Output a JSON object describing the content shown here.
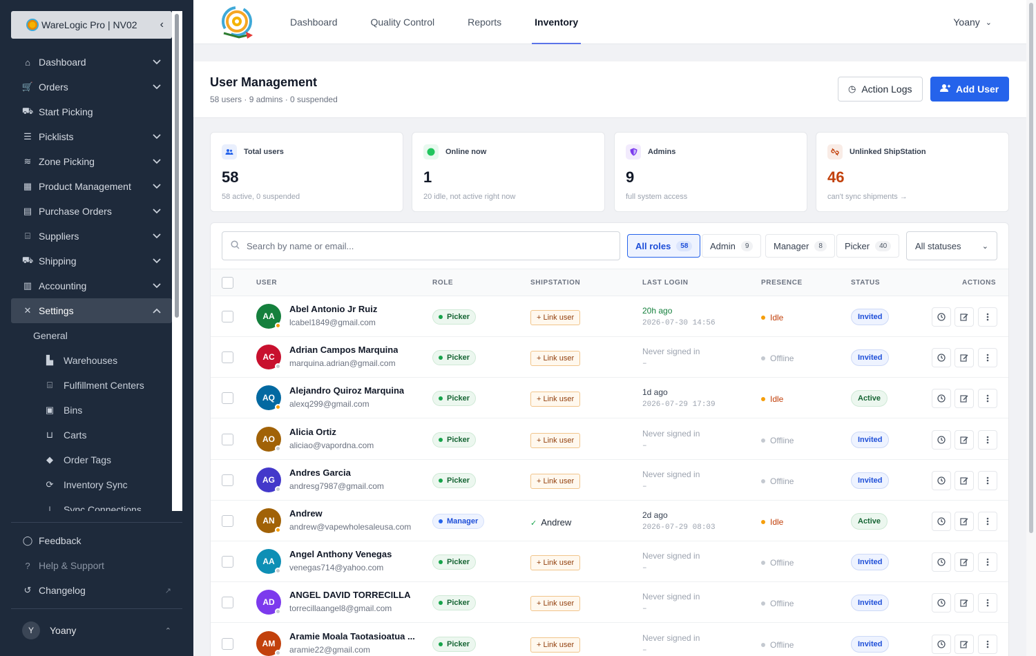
{
  "org": {
    "name": "WareLogic Pro | NV02"
  },
  "sidebar": {
    "items": [
      {
        "label": "Dashboard",
        "icon": "home-icon",
        "has_chevron": true
      },
      {
        "label": "Orders",
        "icon": "cart-icon",
        "has_chevron": true
      },
      {
        "label": "Start Picking",
        "icon": "dolly-icon",
        "has_chevron": false
      },
      {
        "label": "Picklists",
        "icon": "list-icon",
        "has_chevron": true
      },
      {
        "label": "Zone Picking",
        "icon": "layers-icon",
        "has_chevron": true
      },
      {
        "label": "Product Management",
        "icon": "boxes-icon",
        "has_chevron": true
      },
      {
        "label": "Purchase Orders",
        "icon": "document-icon",
        "has_chevron": true
      },
      {
        "label": "Suppliers",
        "icon": "warehouse-icon",
        "has_chevron": true
      },
      {
        "label": "Shipping",
        "icon": "truck-icon",
        "has_chevron": true
      },
      {
        "label": "Accounting",
        "icon": "calculator-icon",
        "has_chevron": true
      },
      {
        "label": "Settings",
        "icon": "tools-icon",
        "has_chevron": true,
        "active": true
      }
    ],
    "settings_group": "General",
    "sub_items": [
      {
        "label": "Warehouses",
        "icon": "industry-icon"
      },
      {
        "label": "Fulfillment Centers",
        "icon": "warehouse-icon"
      },
      {
        "label": "Bins",
        "icon": "box-open-icon"
      },
      {
        "label": "Carts",
        "icon": "cart-flatbed-icon"
      },
      {
        "label": "Order Tags",
        "icon": "tags-icon"
      },
      {
        "label": "Inventory Sync",
        "icon": "sync-icon"
      },
      {
        "label": "Sync Connections",
        "icon": "plug-icon"
      }
    ],
    "bottom": [
      {
        "label": "Feedback",
        "icon": "chat-icon"
      },
      {
        "label": "Help & Support",
        "icon": "help-icon"
      },
      {
        "label": "Changelog",
        "icon": "history-icon"
      }
    ],
    "user": {
      "initial": "Y",
      "name": "Yoany"
    }
  },
  "topnav": {
    "tabs": [
      "Dashboard",
      "Quality Control",
      "Reports",
      "Inventory"
    ],
    "active_tab": "Inventory",
    "user": "Yoany"
  },
  "header": {
    "title": "User Management",
    "subtitle": "58 users · 9 admins · 0 suspended",
    "action_logs": "Action Logs",
    "add_user": "Add User"
  },
  "stats": [
    {
      "label": "Total users",
      "value": "58",
      "note": "58 active, 0 suspended",
      "icon": "users-icon",
      "accent": "#2563eb"
    },
    {
      "label": "Online now",
      "value": "1",
      "note": "20 idle, not active right now",
      "icon": "online-dot-icon",
      "accent": "#22c55e"
    },
    {
      "label": "Admins",
      "value": "9",
      "note": "full system access",
      "icon": "shield-icon",
      "accent": "#7c3aed"
    },
    {
      "label": "Unlinked ShipStation",
      "value": "46",
      "note": "can't sync shipments →",
      "icon": "unlink-icon",
      "accent": "#c2410c"
    }
  ],
  "filters": {
    "search_placeholder": "Search by name or email...",
    "roles": [
      {
        "label": "All roles",
        "count": "58",
        "active": true
      },
      {
        "label": "Admin",
        "count": "9"
      },
      {
        "label": "Manager",
        "count": "8"
      },
      {
        "label": "Picker",
        "count": "40"
      }
    ],
    "status": "All statuses"
  },
  "table": {
    "columns": [
      "USER",
      "ROLE",
      "SHIPSTATION",
      "LAST LOGIN",
      "PRESENCE",
      "STATUS",
      "ACTIONS"
    ],
    "rows": [
      {
        "initials": "AA",
        "color": "#15803d",
        "name": "Abel Antonio Jr Ruiz",
        "email": "lcabel1849@gmail.com",
        "role": "Picker",
        "shipstation": "+ Link user",
        "linked": false,
        "login": "20h ago",
        "login_ts": "2026-07-30 14:56",
        "presence": "Idle",
        "status": "Invited"
      },
      {
        "initials": "AC",
        "color": "#c8102e",
        "name": "Adrian Campos Marquina",
        "email": "marquina.adrian@gmail.com",
        "role": "Picker",
        "shipstation": "+ Link user",
        "linked": false,
        "login": "Never signed in",
        "login_ts": "–",
        "presence": "Offline",
        "status": "Invited"
      },
      {
        "initials": "AQ",
        "color": "#0369a1",
        "name": "Alejandro Quiroz Marquina",
        "email": "alexq299@gmail.com",
        "role": "Picker",
        "shipstation": "+ Link user",
        "linked": false,
        "login": "1d ago",
        "login_ts": "2026-07-29 17:39",
        "presence": "Idle",
        "status": "Active"
      },
      {
        "initials": "AO",
        "color": "#a16207",
        "name": "Alicia Ortiz",
        "email": "aliciao@vapordna.com",
        "role": "Picker",
        "shipstation": "+ Link user",
        "linked": false,
        "login": "Never signed in",
        "login_ts": "–",
        "presence": "Offline",
        "status": "Invited"
      },
      {
        "initials": "AG",
        "color": "#4338ca",
        "name": "Andres Garcia",
        "email": "andresg7987@gmail.com",
        "role": "Picker",
        "shipstation": "+ Link user",
        "linked": false,
        "login": "Never signed in",
        "login_ts": "–",
        "presence": "Offline",
        "status": "Invited"
      },
      {
        "initials": "AN",
        "color": "#a16207",
        "name": "Andrew",
        "email": "andrew@vapewholesaleusa.com",
        "role": "Manager",
        "shipstation": "Andrew",
        "linked": true,
        "login": "2d ago",
        "login_ts": "2026-07-29 08:03",
        "presence": "Idle",
        "status": "Active"
      },
      {
        "initials": "AA",
        "color": "#0e8fb5",
        "name": "Angel Anthony Venegas",
        "email": "venegas714@yahoo.com",
        "role": "Picker",
        "shipstation": "+ Link user",
        "linked": false,
        "login": "Never signed in",
        "login_ts": "–",
        "presence": "Offline",
        "status": "Invited"
      },
      {
        "initials": "AD",
        "color": "#7c3aed",
        "name": "ANGEL DAVID TORRECILLA",
        "email": "torrecillaangel8@gmail.com",
        "role": "Picker",
        "shipstation": "+ Link user",
        "linked": false,
        "login": "Never signed in",
        "login_ts": "–",
        "presence": "Offline",
        "status": "Invited"
      },
      {
        "initials": "AM",
        "color": "#c2410c",
        "name": "Aramie Moala Taotasioatua ...",
        "email": "aramie22@gmail.com",
        "role": "Picker",
        "shipstation": "+ Link user",
        "linked": false,
        "login": "Never signed in",
        "login_ts": "–",
        "presence": "Offline",
        "status": "Invited"
      }
    ]
  }
}
